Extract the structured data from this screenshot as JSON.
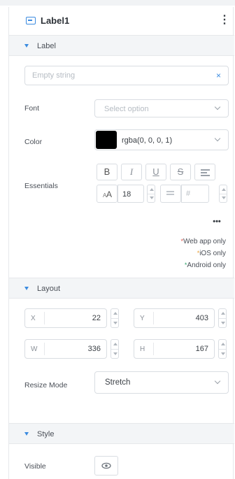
{
  "header": {
    "title": "Label1",
    "menu_icon": "kebab-menu-icon"
  },
  "sections": {
    "label": "Label",
    "layout": "Layout",
    "style": "Style"
  },
  "label_section": {
    "text_placeholder": "Empty string",
    "clear_glyph": "×",
    "font_label": "Font",
    "font_placeholder": "Select option",
    "color_label": "Color",
    "color_value": "rgba(0, 0, 0, 1)",
    "color_swatch": "#000000",
    "essentials_label": "Essentials",
    "buttons": {
      "bold": "B",
      "italic": "I",
      "underline": "U",
      "strike": "S",
      "size_glyph": "A",
      "size_prefix": "A"
    },
    "font_size": "18",
    "line_height_glyph": "#",
    "more_glyph": "•••",
    "notes": {
      "web": "Web app only",
      "ios": "iOS only",
      "android": "Android only",
      "star": "*"
    },
    "note_colors": {
      "web": "#e0564a",
      "ios": "#e9a23b",
      "android": "#2fa36b"
    }
  },
  "layout_section": {
    "x_label": "X",
    "x_value": "22",
    "y_label": "Y",
    "y_value": "403",
    "w_label": "W",
    "w_value": "336",
    "h_label": "H",
    "h_value": "167",
    "resize_label": "Resize Mode",
    "resize_value": "Stretch"
  },
  "style_section": {
    "visible_label": "Visible",
    "visible_icon": "eye-icon"
  },
  "colors": {
    "accent": "#3b8be0"
  }
}
